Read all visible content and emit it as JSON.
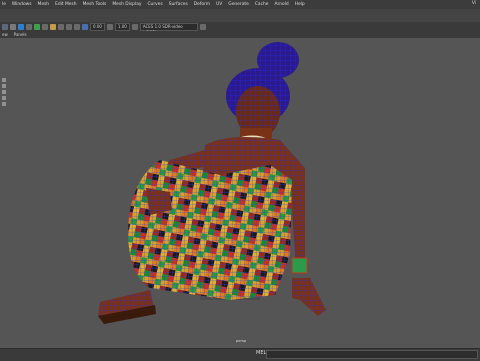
{
  "menubar": {
    "items": [
      "le",
      "Windows",
      "Mesh",
      "Edit Mesh",
      "Mesh Tools",
      "Mesh Display",
      "Curves",
      "Surfaces",
      "Deform",
      "UV",
      "Generate",
      "Cache",
      "Arnold",
      "Help"
    ],
    "right_label": "Vi"
  },
  "toolbar": {
    "field1": "0.00",
    "field2": "1.00",
    "colorspace": "ACES 1.0 SDR-video (sRGB)"
  },
  "subbar": {
    "items": [
      "ew",
      "Panels"
    ]
  },
  "viewport": {
    "camera_label": "persp"
  },
  "statusbar": {
    "mel_label": "MEL"
  },
  "colors": {
    "viewport_bg": "#555555",
    "wire": "#1f2bff",
    "skin": "#7a3216"
  }
}
